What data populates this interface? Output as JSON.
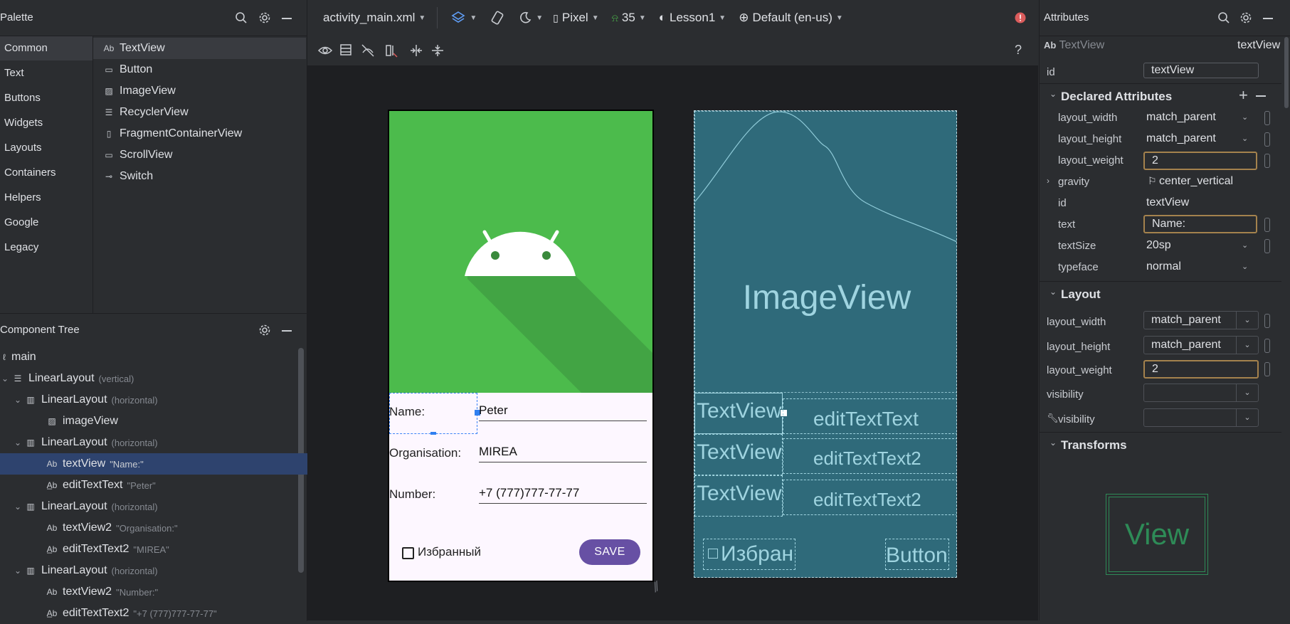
{
  "palette": {
    "title": "Palette",
    "categories": [
      "Common",
      "Text",
      "Buttons",
      "Widgets",
      "Layouts",
      "Containers",
      "Helpers",
      "Google",
      "Legacy"
    ],
    "items": [
      {
        "icon": "Ab",
        "label": "TextView"
      },
      {
        "icon": "▭",
        "label": "Button"
      },
      {
        "icon": "▨",
        "label": "ImageView"
      },
      {
        "icon": "☰",
        "label": "RecyclerView"
      },
      {
        "icon": "▯",
        "label": "FragmentContainerView"
      },
      {
        "icon": "▭",
        "label": "ScrollView"
      },
      {
        "icon": "⊸",
        "label": "Switch"
      }
    ]
  },
  "tree": {
    "title": "Component Tree",
    "rows": [
      {
        "label": "main",
        "hint": ""
      },
      {
        "label": "LinearLayout",
        "hint": "(vertical)"
      },
      {
        "label": "LinearLayout",
        "hint": "(horizontal)"
      },
      {
        "label": "imageView",
        "hint": ""
      },
      {
        "label": "LinearLayout",
        "hint": "(horizontal)"
      },
      {
        "label": "textView",
        "hint": "\"Name:\""
      },
      {
        "label": "editTextText",
        "hint": "\"Peter\""
      },
      {
        "label": "LinearLayout",
        "hint": "(horizontal)"
      },
      {
        "label": "textView2",
        "hint": "\"Organisation:\""
      },
      {
        "label": "editTextText2",
        "hint": "\"MIREA\""
      },
      {
        "label": "LinearLayout",
        "hint": "(horizontal)"
      },
      {
        "label": "textView2",
        "hint": "\"Number:\""
      },
      {
        "label": "editTextText2",
        "hint": "\"+7 (777)777-77-77\""
      }
    ]
  },
  "toolbar": {
    "file": "activity_main.xml",
    "device": "Pixel",
    "api": "35",
    "theme": "Lesson1",
    "locale": "Default (en-us)",
    "help": "?"
  },
  "design": {
    "name_label": "Name:",
    "name_value": "Peter",
    "org_label": "Organisation:",
    "org_value": "MIREA",
    "number_label": "Number:",
    "number_value": "+7 (777)777-77-77",
    "checkbox_label": "Избранный",
    "save_button": "SAVE"
  },
  "blueprint": {
    "imageview": "ImageView",
    "textview1": "TextView",
    "textview2": "TextView",
    "textview3": "TextView",
    "edit1": "editTextText",
    "edit2": "editTextText2",
    "edit3": "editTextText2",
    "checkbox": "Избран",
    "button": "Button"
  },
  "attributes": {
    "title": "Attributes",
    "widget_type": "TextView",
    "widget_id": "textView",
    "id_label": "id",
    "id_value": "textView",
    "declared_title": "Declared Attributes",
    "declared": [
      {
        "name": "layout_width",
        "value": "match_parent"
      },
      {
        "name": "layout_height",
        "value": "match_parent"
      },
      {
        "name": "layout_weight",
        "value": "2"
      },
      {
        "name": "gravity",
        "value": "center_vertical"
      },
      {
        "name": "id",
        "value": "textView"
      },
      {
        "name": "text",
        "value": "Name:"
      },
      {
        "name": "textSize",
        "value": "20sp"
      },
      {
        "name": "typeface",
        "value": "normal"
      }
    ],
    "layout_title": "Layout",
    "layout": [
      {
        "name": "layout_width",
        "value": "match_parent"
      },
      {
        "name": "layout_height",
        "value": "match_parent"
      },
      {
        "name": "layout_weight",
        "value": "2"
      },
      {
        "name": "visibility",
        "value": ""
      },
      {
        "name": "visibility",
        "value": ""
      }
    ],
    "transforms_title": "Transforms",
    "preview_label": "View"
  },
  "colors": {
    "accent_green": "#4cbb4c",
    "android_head": "#ffffff",
    "save_button": "#6750a4",
    "blueprint_bg": "#2f6a7a",
    "selection_blue": "#2e436e",
    "focus_border": "#a4824d",
    "warning": "#e5c04b",
    "error": "#db5c5c"
  }
}
